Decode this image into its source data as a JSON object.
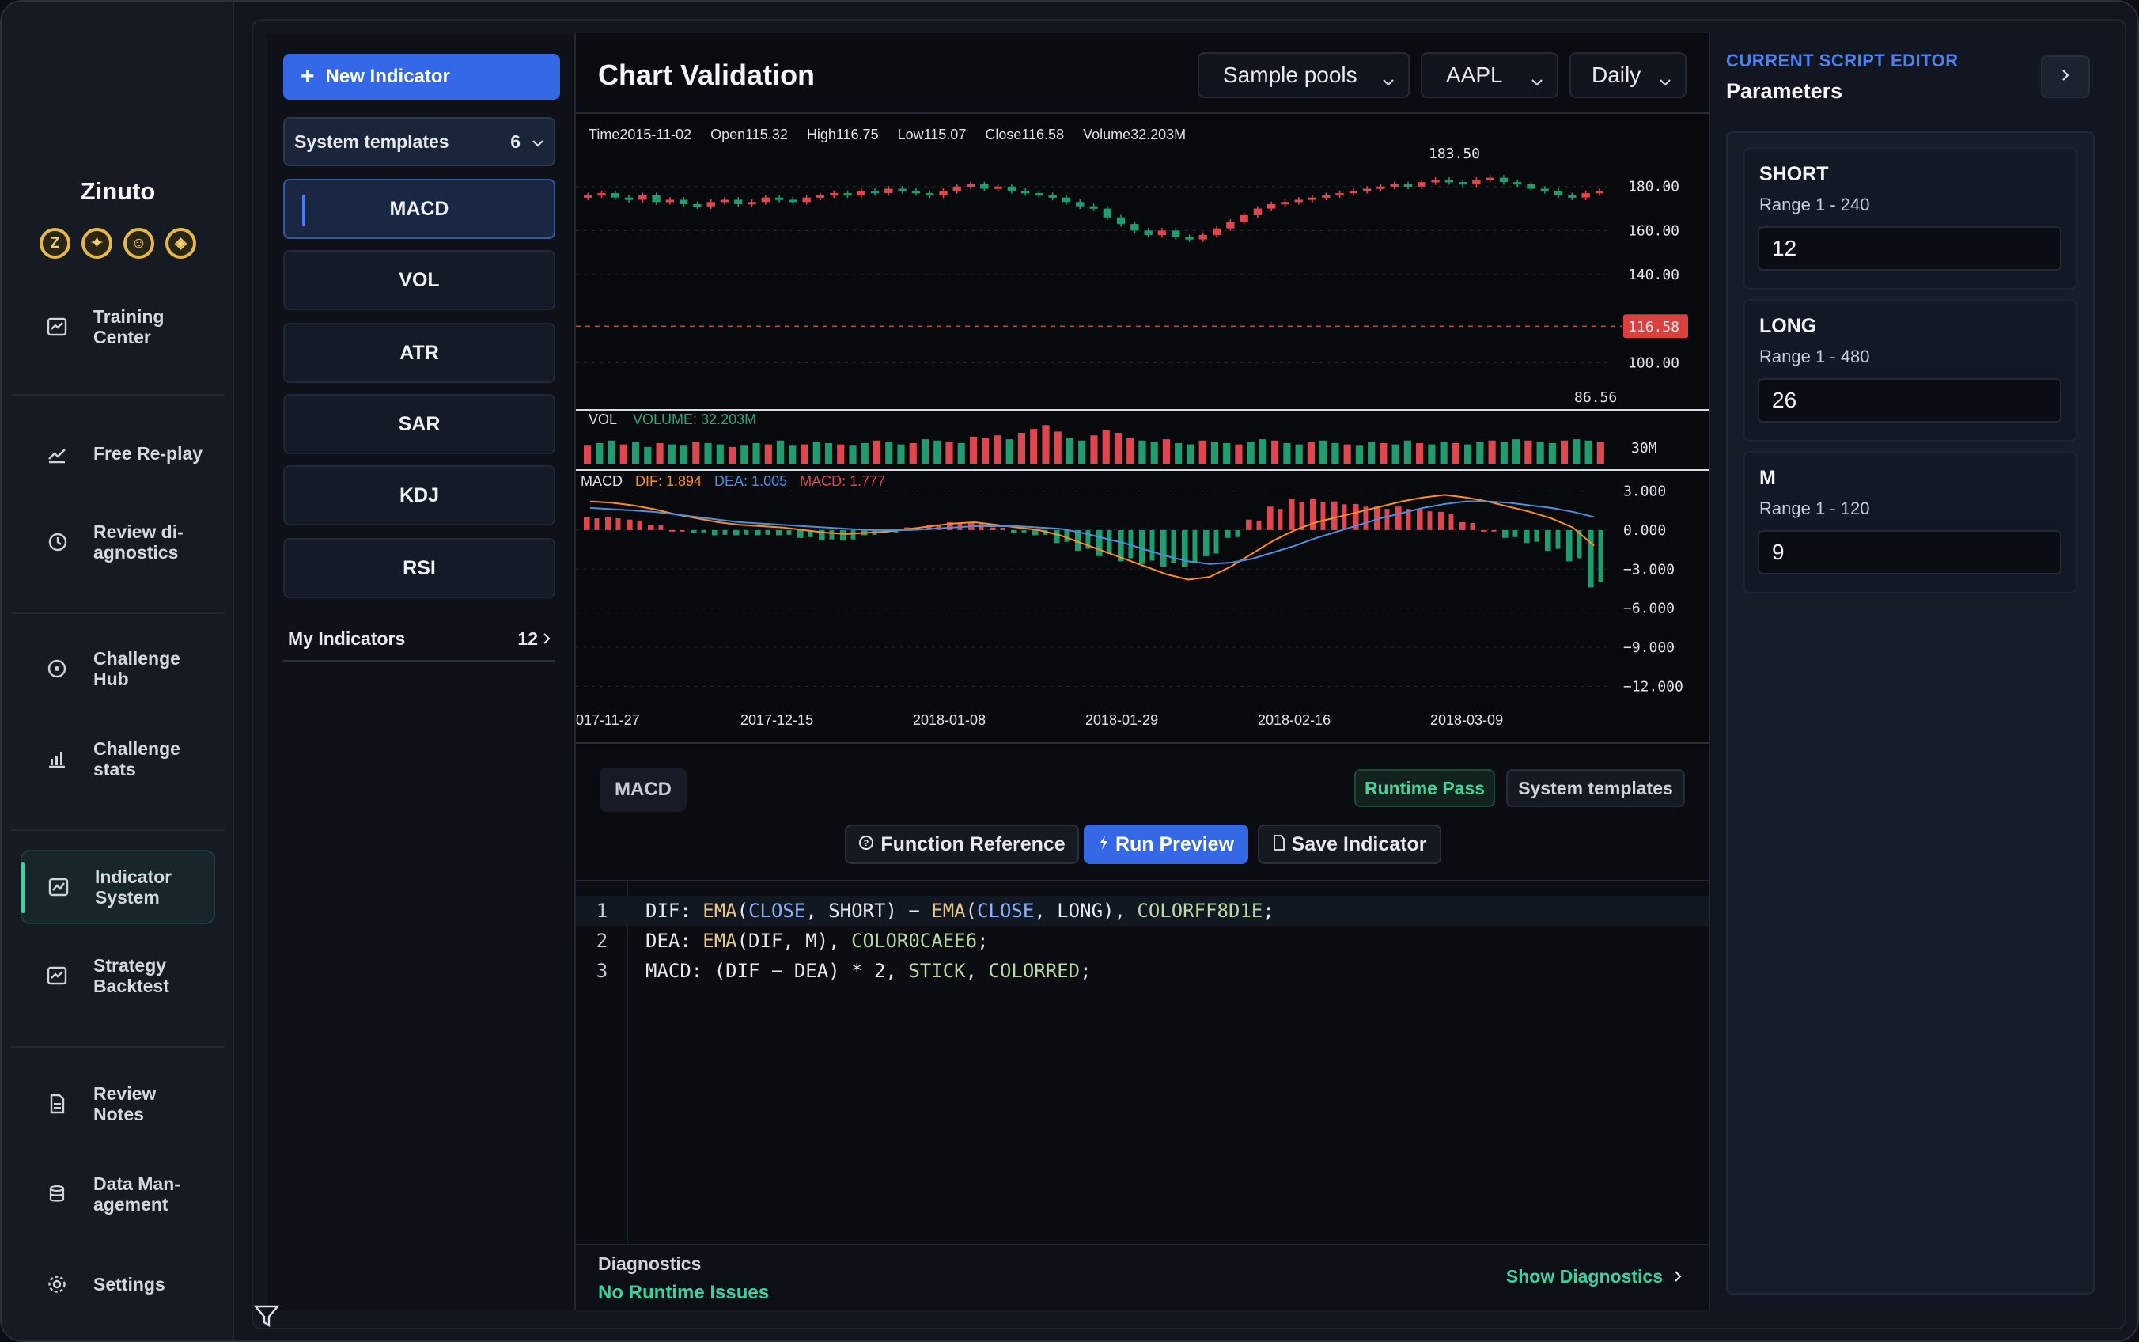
{
  "app": {
    "brand": "Zinuto",
    "coins": [
      "Z",
      "✦",
      "☺",
      "◈"
    ]
  },
  "sidebar": {
    "items": [
      {
        "label": "Training Center",
        "icon": "training-icon"
      },
      {
        "label": "Free Re-play",
        "icon": "trend-icon"
      },
      {
        "label": "Review di-agnostics",
        "icon": "history-icon"
      },
      {
        "label": "Challenge Hub",
        "icon": "target-icon"
      },
      {
        "label": "Challenge stats",
        "icon": "stats-icon"
      },
      {
        "label": "Indicator System",
        "icon": "line-chart-icon",
        "active": true
      },
      {
        "label": "Strategy Backtest",
        "icon": "backtest-icon"
      },
      {
        "label": "Review Notes",
        "icon": "notes-icon"
      },
      {
        "label": "Data Man-agement",
        "icon": "database-icon"
      },
      {
        "label": "Settings",
        "icon": "gear-icon"
      }
    ]
  },
  "indicators": {
    "new_button": "New Indicator",
    "system_templates_label": "System templates",
    "system_templates_count": "6",
    "list": [
      "MACD",
      "VOL",
      "ATR",
      "SAR",
      "KDJ",
      "RSI"
    ],
    "selected": "MACD",
    "my_indicators_label": "My Indicators",
    "my_indicators_count": "12"
  },
  "chart": {
    "title": "Chart Validation",
    "pool_select": "Sample pools",
    "symbol_select": "AAPL",
    "period_select": "Daily",
    "ohlc": {
      "time": "Time2015-11-02",
      "open": "Open115.32",
      "high": "High116.75",
      "low": "Low115.07",
      "close": "Close116.58",
      "volume": "Volume32.203M"
    },
    "vol_label": "VOL",
    "vol_value": "VOLUME: 32.203M",
    "macd_label": "MACD",
    "dif_value": "DIF: 1.894",
    "dea_value": "DEA: 1.005",
    "macd_value": "MACD: 1.777",
    "colors": {
      "up": "#e0464f",
      "down": "#1f9d6e",
      "dif": "#ff8d1e",
      "dea": "#4c8fe0",
      "accent": "#3568e6"
    }
  },
  "chart_data": [
    {
      "type": "candlestick",
      "title": "",
      "y_ticks": [
        "180.00",
        "160.00",
        "140.00",
        "100.00"
      ],
      "max_label": "183.50",
      "min_label": "86.56",
      "current_price": "116.58",
      "ylim": [
        80,
        195
      ],
      "closes": [
        176,
        177,
        175,
        174,
        176,
        173,
        174,
        172,
        171,
        173,
        174,
        172,
        173,
        175,
        174,
        173,
        175,
        176,
        177,
        176,
        178,
        177,
        179,
        178,
        177,
        176,
        178,
        180,
        181,
        179,
        180,
        178,
        177,
        176,
        175,
        173,
        171,
        170,
        166,
        163,
        160,
        158,
        160,
        157,
        156,
        158,
        161,
        164,
        167,
        170,
        172,
        173,
        174,
        175,
        176,
        177,
        178,
        179,
        180,
        181,
        180,
        182,
        183,
        182,
        181,
        183,
        184,
        182,
        181,
        179,
        178,
        176,
        175,
        177,
        178
      ],
      "x_ticks": [
        "017-11-27",
        "2017-12-15",
        "2018-01-08",
        "2018-01-29",
        "2018-02-16",
        "2018-03-09"
      ]
    },
    {
      "type": "bar",
      "title": "",
      "series_name": "VOL",
      "y_ticks": [
        "30M"
      ],
      "values": [
        14,
        16,
        18,
        15,
        17,
        13,
        16,
        15,
        14,
        17,
        16,
        15,
        13,
        14,
        16,
        15,
        18,
        14,
        15,
        17,
        16,
        15,
        14,
        16,
        18,
        17,
        15,
        16,
        19,
        18,
        17,
        16,
        21,
        20,
        22,
        19,
        24,
        27,
        30,
        25,
        20,
        18,
        22,
        26,
        24,
        20,
        18,
        17,
        19,
        16,
        15,
        18,
        17,
        16,
        15,
        17,
        19,
        18,
        16,
        15,
        17,
        18,
        16,
        15,
        14,
        17,
        16,
        15,
        18,
        16,
        15,
        17,
        16,
        15,
        17,
        18,
        17,
        19,
        18,
        17,
        16,
        18,
        19,
        18,
        17
      ]
    },
    {
      "type": "bar",
      "title": "",
      "series": [
        {
          "name": "DIF",
          "values": [
            2.2,
            2.1,
            1.9,
            1.6,
            1.2,
            0.9,
            0.6,
            0.4,
            0.3,
            0.2,
            0.0,
            -0.2,
            -0.3,
            -0.2,
            -0.1,
            0.1,
            0.3,
            0.5,
            0.6,
            0.4,
            0.2,
            0.0,
            -0.4,
            -1.0,
            -1.6,
            -2.2,
            -2.8,
            -3.4,
            -3.8,
            -3.6,
            -2.8,
            -1.8,
            -0.8,
            0.0,
            0.6,
            1.0,
            1.4,
            1.8,
            2.2,
            2.5,
            2.7,
            2.5,
            2.2,
            1.8,
            1.4,
            0.9,
            0.2,
            -1.2
          ]
        },
        {
          "name": "DEA",
          "values": [
            1.7,
            1.6,
            1.5,
            1.4,
            1.2,
            1.0,
            0.8,
            0.6,
            0.5,
            0.4,
            0.3,
            0.2,
            0.1,
            0.0,
            0.0,
            0.0,
            0.1,
            0.2,
            0.3,
            0.3,
            0.3,
            0.2,
            0.1,
            -0.2,
            -0.6,
            -1.0,
            -1.5,
            -2.0,
            -2.4,
            -2.6,
            -2.5,
            -2.2,
            -1.7,
            -1.2,
            -0.6,
            -0.1,
            0.4,
            0.9,
            1.3,
            1.7,
            2.0,
            2.2,
            2.2,
            2.1,
            1.9,
            1.7,
            1.4,
            1.0
          ]
        },
        {
          "name": "MACD",
          "values": [
            1.0,
            1.0,
            0.8,
            0.4,
            0.0,
            -0.2,
            -0.4,
            -0.4,
            -0.4,
            -0.4,
            -0.6,
            -0.8,
            -0.8,
            -0.4,
            -0.2,
            0.2,
            0.4,
            0.6,
            0.6,
            0.2,
            -0.2,
            -0.4,
            -1.0,
            -1.6,
            -2.0,
            -2.4,
            -2.6,
            -2.8,
            -2.8,
            -2.0,
            -0.6,
            0.8,
            1.8,
            2.4,
            2.4,
            2.2,
            2.0,
            1.8,
            1.8,
            1.6,
            1.4,
            0.6,
            0.0,
            -0.6,
            -1.0,
            -1.6,
            -2.4,
            -4.4
          ]
        }
      ],
      "y_ticks": [
        "3.000",
        "0.000",
        "−3.000",
        "−6.000",
        "−9.000",
        "−12.000"
      ],
      "ylim": [
        -13,
        4
      ]
    }
  ],
  "script": {
    "name_tag": "MACD",
    "runtime_pill": "Runtime Pass",
    "templates_pill": "System templates",
    "function_ref": "Function Reference",
    "run_preview": "Run Preview",
    "save_indicator": "Save Indicator",
    "lines": [
      "DIF: EMA(CLOSE, SHORT) − EMA(CLOSE, LONG), COLORFF8D1E;",
      "DEA: EMA(DIF, M), COLOR0CAEE6;",
      "MACD: (DIF − DEA) * 2, STICK, COLORRED;"
    ]
  },
  "diagnostics": {
    "title": "Diagnostics",
    "status": "No Runtime Issues",
    "show_link": "Show Diagnostics"
  },
  "editor_panel": {
    "eyebrow": "CURRENT SCRIPT EDITOR",
    "title": "Parameters",
    "params": [
      {
        "name": "SHORT",
        "range": "Range 1 - 240",
        "value": "12"
      },
      {
        "name": "LONG",
        "range": "Range 1 - 480",
        "value": "26"
      },
      {
        "name": "M",
        "range": "Range 1 - 120",
        "value": "9"
      }
    ]
  }
}
